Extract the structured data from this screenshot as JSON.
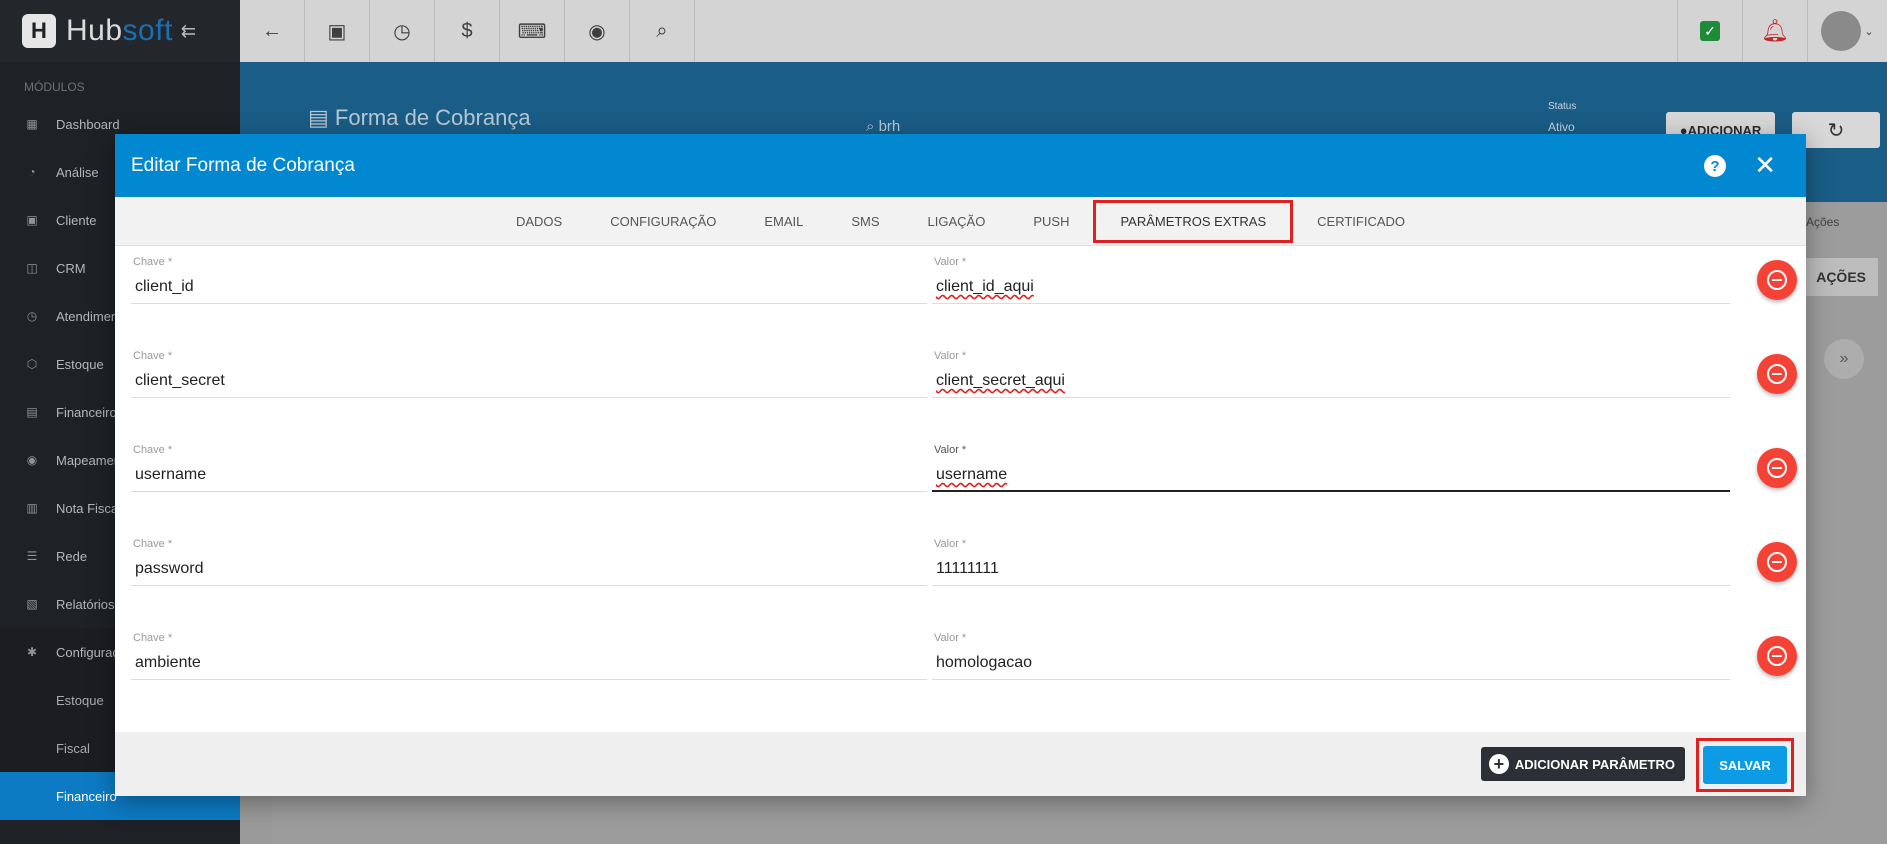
{
  "brand": {
    "name_a": "Hub",
    "name_b": "soft"
  },
  "sidebar": {
    "section_label": "MÓDULOS",
    "items": [
      {
        "icon": "dashboard-icon",
        "glyph": "▦",
        "label": "Dashboard"
      },
      {
        "icon": "analysis-icon",
        "glyph": "◔",
        "label": "Análise"
      },
      {
        "icon": "client-icon",
        "glyph": "▣",
        "label": "Cliente"
      },
      {
        "icon": "crm-icon",
        "glyph": "◫",
        "label": "CRM"
      },
      {
        "icon": "attendance-icon",
        "glyph": "◷",
        "label": "Atendimento"
      },
      {
        "icon": "stock-icon",
        "glyph": "⬡",
        "label": "Estoque"
      },
      {
        "icon": "finance-icon",
        "glyph": "▤",
        "label": "Financeiro"
      },
      {
        "icon": "map-icon",
        "glyph": "◉",
        "label": "Mapeamento"
      },
      {
        "icon": "invoice-icon",
        "glyph": "▥",
        "label": "Nota Fiscal"
      },
      {
        "icon": "network-icon",
        "glyph": "☰",
        "label": "Rede"
      },
      {
        "icon": "reports-icon",
        "glyph": "▧",
        "label": "Relatórios"
      },
      {
        "icon": "settings-icon",
        "glyph": "✱",
        "label": "Configurações"
      }
    ],
    "sub_items": [
      "Estoque",
      "Fiscal",
      "Financeiro"
    ]
  },
  "page": {
    "title": "Forma de Cobrança",
    "search_value": "brh",
    "status_label": "Status",
    "status_value": "Ativo",
    "add_label": "ADICIONAR",
    "acoes_label": "Ações",
    "acoes_button": "AÇÕES"
  },
  "modal": {
    "title": "Editar Forma de Cobrança",
    "tabs": [
      "DADOS",
      "CONFIGURAÇÃO",
      "EMAIL",
      "SMS",
      "LIGAÇÃO",
      "PUSH",
      "PARÂMETROS EXTRAS",
      "CERTIFICADO"
    ],
    "active_tab": "PARÂMETROS EXTRAS",
    "key_label": "Chave *",
    "value_label": "Valor *",
    "params": [
      {
        "key": "client_id",
        "value": "client_id_aqui"
      },
      {
        "key": "client_secret",
        "value": "client_secret_aqui"
      },
      {
        "key": "username",
        "value": "username"
      },
      {
        "key": "password",
        "value": "11111111"
      },
      {
        "key": "ambiente",
        "value": "homologacao"
      }
    ],
    "add_param_label": "ADICIONAR PARÂMETRO",
    "save_label": "SALVAR"
  },
  "colors": {
    "accent": "#0288d1",
    "highlight": "#e02020",
    "danger": "#f44336"
  }
}
